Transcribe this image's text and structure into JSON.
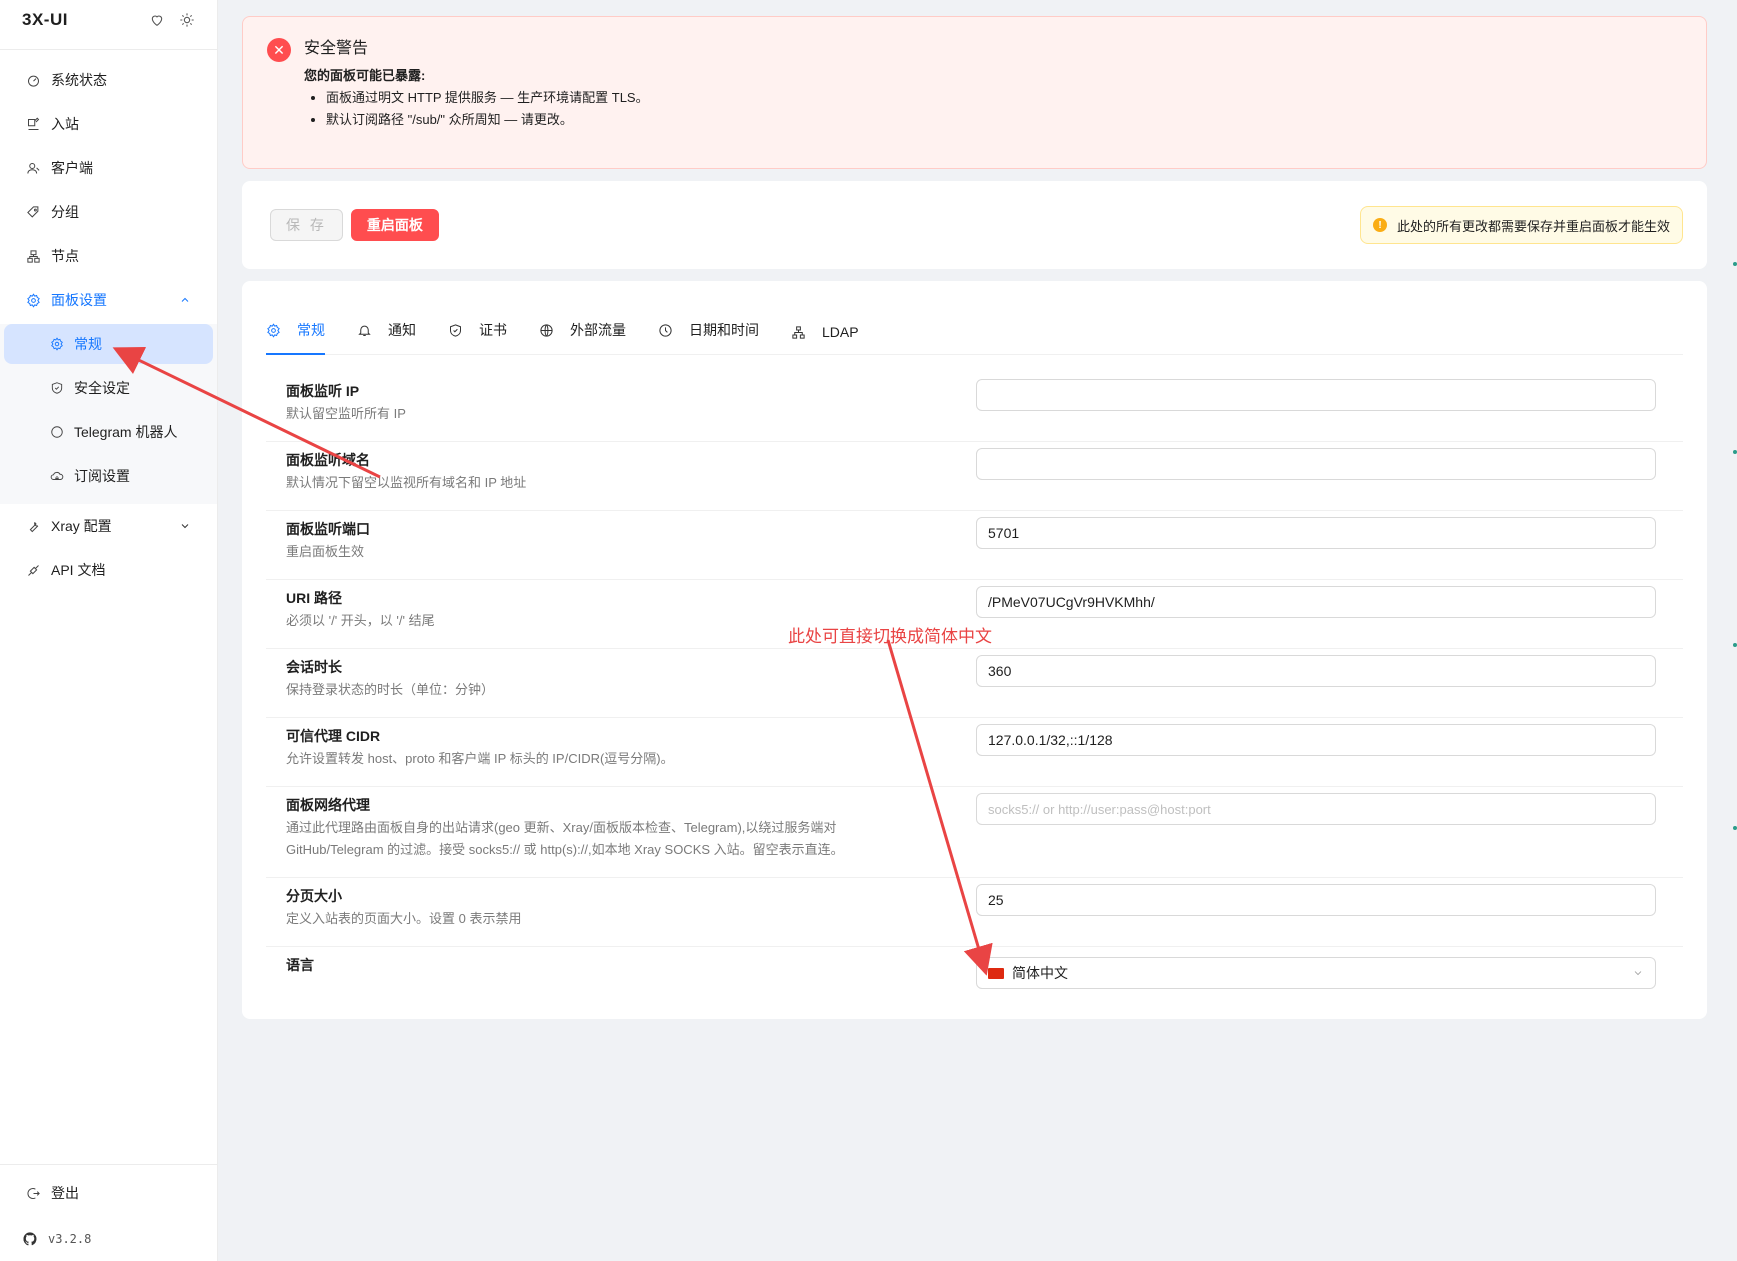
{
  "app": {
    "brand": "3X-UI",
    "version": "v3.2.8"
  },
  "sidebar": {
    "items": [
      {
        "label": "系统状态",
        "icon": "dashboard-icon"
      },
      {
        "label": "入站",
        "icon": "edit-icon"
      },
      {
        "label": "客户端",
        "icon": "users-icon"
      },
      {
        "label": "分组",
        "icon": "tag-icon"
      },
      {
        "label": "节点",
        "icon": "cluster-icon"
      },
      {
        "label": "面板设置",
        "icon": "settings-icon",
        "expanded": true
      }
    ],
    "submenu": [
      {
        "label": "常规",
        "icon": "settings-icon",
        "selected": true
      },
      {
        "label": "安全设定",
        "icon": "shield-icon"
      },
      {
        "label": "Telegram 机器人",
        "icon": "chat-icon"
      },
      {
        "label": "订阅设置",
        "icon": "cloud-icon"
      }
    ],
    "items_after": [
      {
        "label": "Xray 配置",
        "icon": "tool-icon"
      },
      {
        "label": "API 文档",
        "icon": "api-icon"
      }
    ],
    "logout": "登出"
  },
  "alert": {
    "title": "安全警告",
    "subtitle": "您的面板可能已暴露:",
    "bullets": [
      "面板通过明文 HTTP 提供服务 — 生产环境请配置 TLS。",
      "默认订阅路径 \"/sub/\" 众所周知 — 请更改。"
    ]
  },
  "actions": {
    "save_label": "保 存",
    "restart_label": "重启面板",
    "notice": "此处的所有更改都需要保存并重启面板才能生效"
  },
  "tabs": [
    {
      "label": "常规",
      "icon": "settings-icon",
      "active": true
    },
    {
      "label": "通知",
      "icon": "bell-icon"
    },
    {
      "label": "证书",
      "icon": "shield-check-icon"
    },
    {
      "label": "外部流量",
      "icon": "globe-icon"
    },
    {
      "label": "日期和时间",
      "icon": "clock-icon"
    },
    {
      "label": "LDAP",
      "icon": "org-icon"
    }
  ],
  "settings": [
    {
      "title": "面板监听 IP",
      "desc": "默认留空监听所有 IP",
      "value": "",
      "placeholder": ""
    },
    {
      "title": "面板监听域名",
      "desc": "默认情况下留空以监视所有域名和 IP 地址",
      "value": "",
      "placeholder": ""
    },
    {
      "title": "面板监听端口",
      "desc": "重启面板生效",
      "value": "5701",
      "placeholder": ""
    },
    {
      "title": "URI 路径",
      "desc": "必须以 '/' 开头，以 '/' 结尾",
      "value": "/PMeV07UCgVr9HVKMhh/",
      "placeholder": ""
    },
    {
      "title": "会话时长",
      "desc": "保持登录状态的时长（单位：分钟）",
      "value": "360",
      "placeholder": ""
    },
    {
      "title": "可信代理 CIDR",
      "desc": "允许设置转发 host、proto 和客户端 IP 标头的 IP/CIDR(逗号分隔)。",
      "value": "127.0.0.1/32,::1/128",
      "placeholder": ""
    },
    {
      "title": "面板网络代理",
      "desc": "通过此代理路由面板自身的出站请求(geo 更新、Xray/面板版本检查、Telegram),以绕过服务端对",
      "desc2": "GitHub/Telegram 的过滤。接受 socks5:// 或 http(s)://,如本地 Xray SOCKS 入站。留空表示直连。",
      "value": "",
      "placeholder": "socks5:// or http://user:pass@host:port"
    },
    {
      "title": "分页大小",
      "desc": "定义入站表的页面大小。设置 0 表示禁用",
      "value": "25",
      "placeholder": ""
    },
    {
      "title": "语言",
      "desc": "",
      "value": "简体中文",
      "placeholder": ""
    }
  ],
  "annotation": {
    "text": "此处可直接切换成简体中文",
    "color": "#e94444"
  },
  "colors": {
    "accent": "#1677ff",
    "danger": "#ff4d4f",
    "warning": "#faad14"
  }
}
